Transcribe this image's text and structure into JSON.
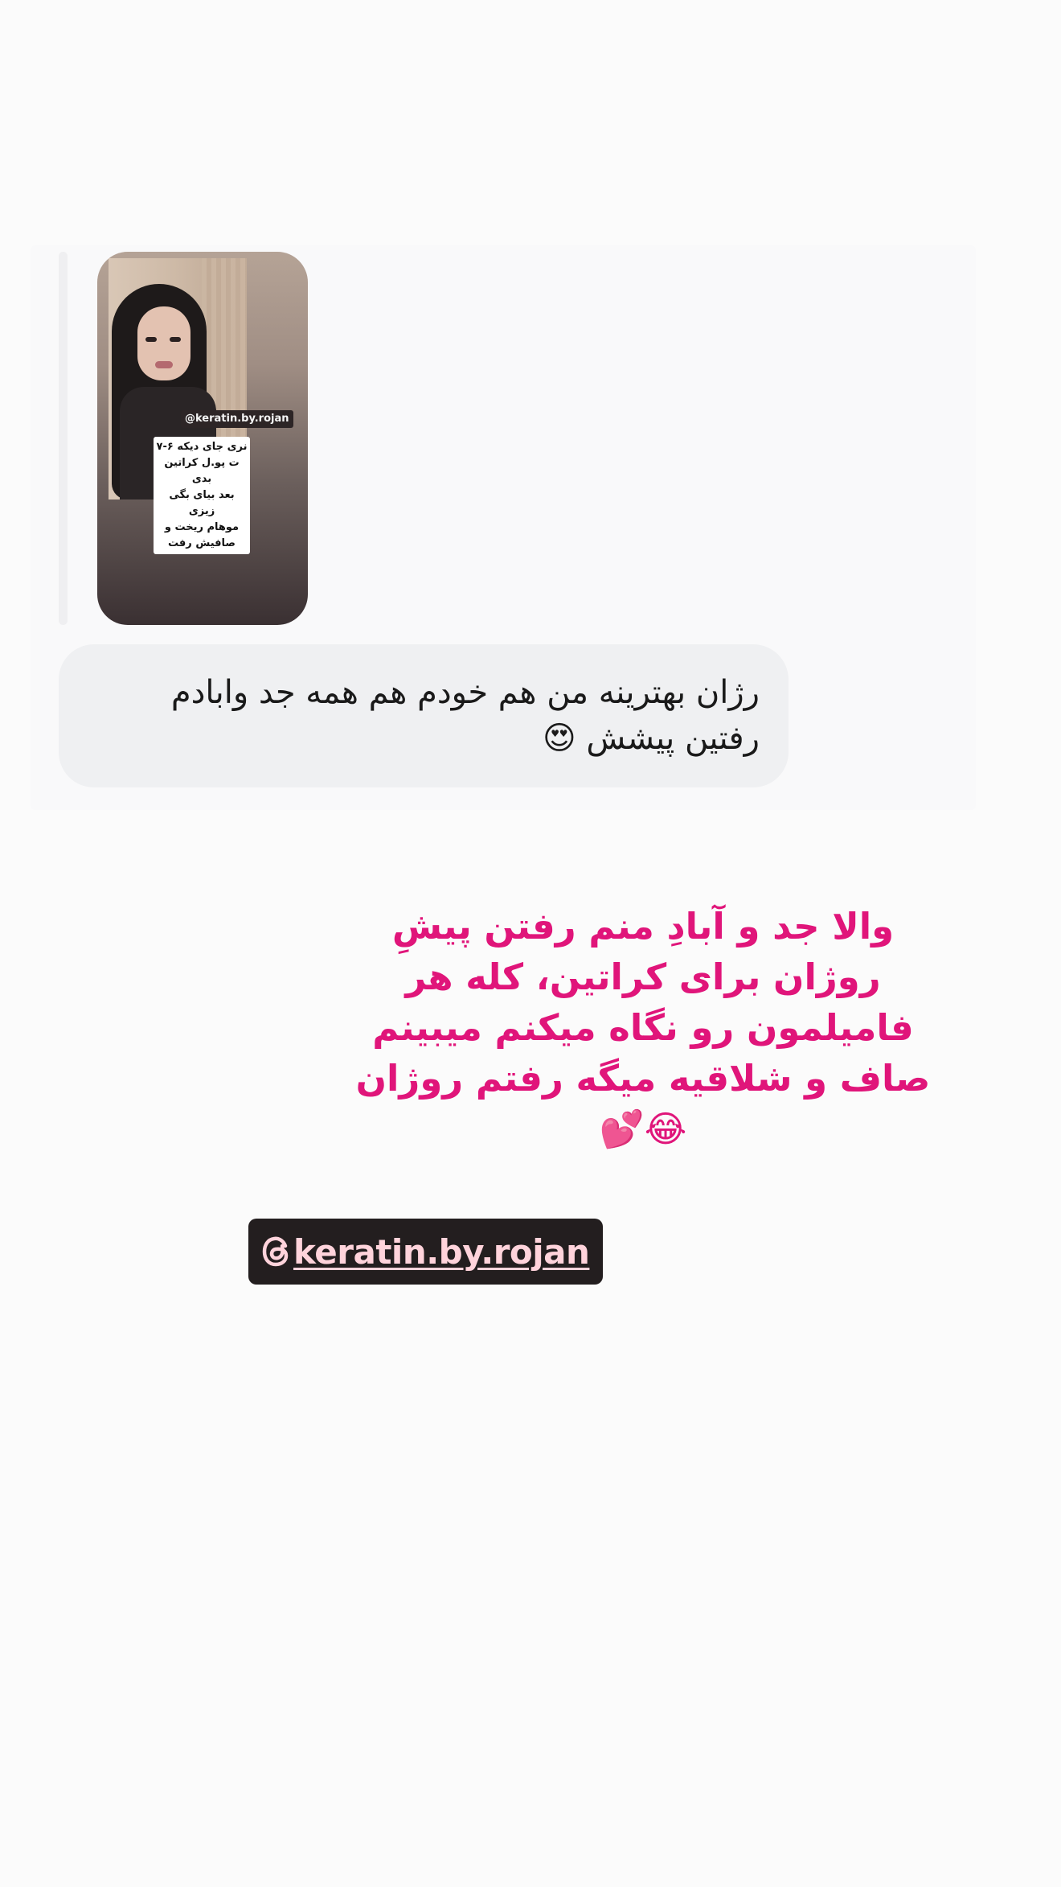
{
  "dm": {
    "story_thumbnail": {
      "mention_tag": "@keratin.by.rojan",
      "caption_lines": [
        "نری جای دیکه ۶-۷",
        "ت پو.ل کراتین بدی",
        "بعد بیای بگی زیزی",
        "موهام ریخت و",
        "صافیش رفت"
      ]
    },
    "reply_message": "رژان بهترینه من هم خودم هم همه جد وابادم رفتین پیشش 😍"
  },
  "story_overlay": {
    "text": "والا جد و آبادِ منم رفتن پیشِ روژان برای کراتین، کله هر فامیلمون رو نگاه میکنم میبینم صاف و شلاقیه میگه رفتم روژان 😂💕"
  },
  "mention_sticker": {
    "handle": "keratin.by.rojan",
    "icon": "threads-icon"
  },
  "colors": {
    "background": "#fbfbfb",
    "bubble": "#eff0f2",
    "overlay_text": "#e0157a",
    "sticker_bg": "#231e1f",
    "sticker_text": "#ffd3db"
  }
}
